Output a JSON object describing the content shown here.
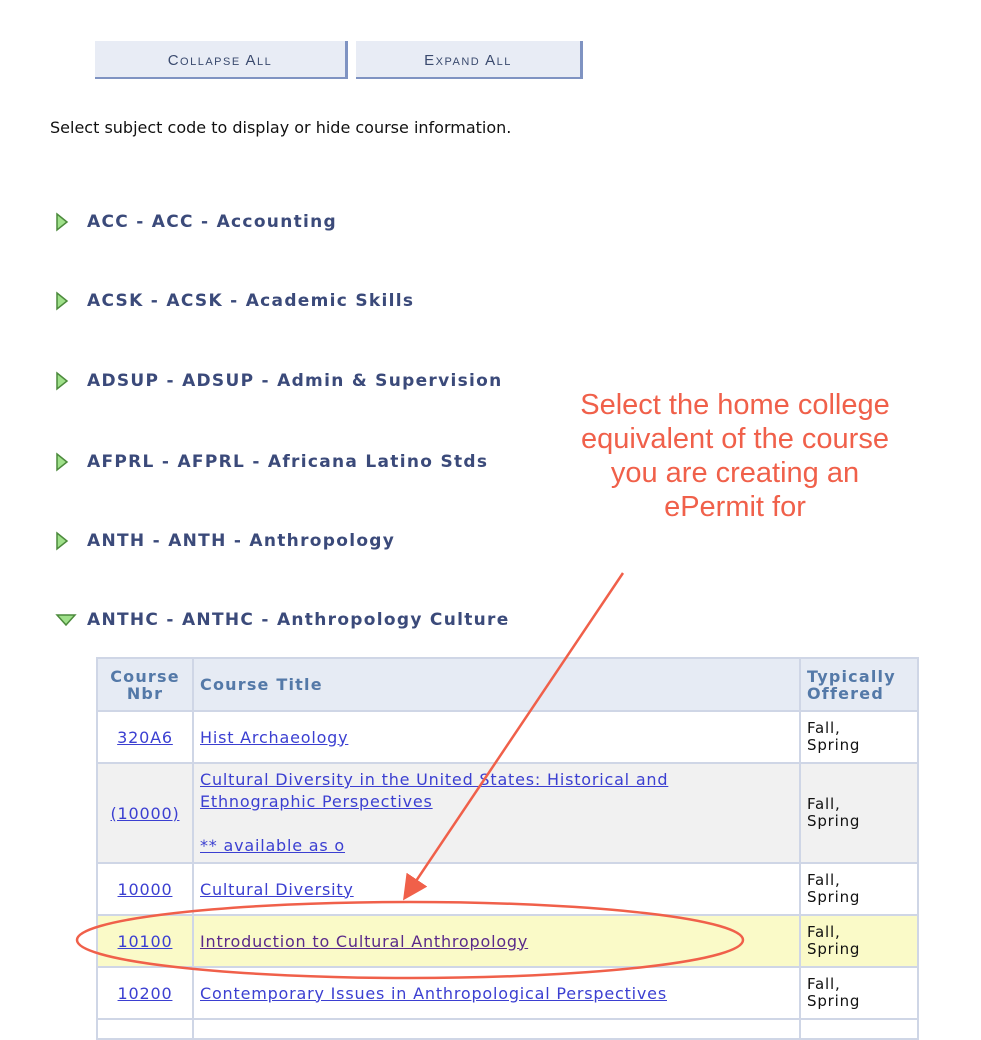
{
  "toolbar": {
    "collapse_all_label": "Collapse All",
    "expand_all_label": "Expand All"
  },
  "instructions": "Select subject code to display or hide course information.",
  "subjects": [
    {
      "label": "ACC - ACC - Accounting",
      "expanded": false
    },
    {
      "label": "ACSK - ACSK - Academic Skills",
      "expanded": false
    },
    {
      "label": "ADSUP - ADSUP - Admin & Supervision",
      "expanded": false
    },
    {
      "label": "AFPRL - AFPRL - Africana Latino Stds",
      "expanded": false
    },
    {
      "label": "ANTH - ANTH - Anthropology",
      "expanded": false
    },
    {
      "label": "ANTHC - ANTHC - Anthropology Culture",
      "expanded": true
    }
  ],
  "course_table": {
    "headers": {
      "nbr_line1": "Course",
      "nbr_line2": "Nbr",
      "title": "Course Title",
      "offered_line1": "Typically",
      "offered_line2": "Offered"
    },
    "rows": [
      {
        "nbr": "320A6",
        "title": "Hist Archaeology",
        "offered_1": "Fall,",
        "offered_2": "Spring"
      },
      {
        "nbr": "(10000)",
        "title_line1": "Cultural Diversity in the United States: Historical and",
        "title_line2": "Ethnographic Perspectives",
        "note": "** available as o",
        "offered_1": "Fall,",
        "offered_2": "Spring"
      },
      {
        "nbr": "10000",
        "title": "Cultural Diversity",
        "offered_1": "Fall,",
        "offered_2": "Spring"
      },
      {
        "nbr": "10100",
        "title": "Introduction to Cultural Anthropology",
        "offered_1": "Fall,",
        "offered_2": "Spring",
        "highlighted": true
      },
      {
        "nbr": "10200",
        "title": "Contemporary Issues in Anthropological Perspectives",
        "offered_1": "Fall,",
        "offered_2": "Spring"
      }
    ]
  },
  "annotation": {
    "text": "Select the home college equivalent of the course you are creating an ePermit for",
    "color": "#f0604a"
  },
  "colors": {
    "subject_text": "#3b4a7a",
    "header_text": "#5479a8",
    "link": "#3b3fd1",
    "highlight_row": "#fafac8",
    "triangle_green": "#8fd67a"
  }
}
